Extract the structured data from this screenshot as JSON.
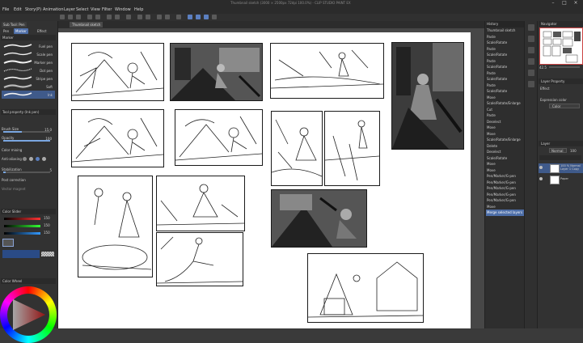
{
  "window": {
    "title": "Thumbnail sketch (3000 × 2500px 72dpi 100.0%) - CLIP STUDIO PAINT EX"
  },
  "menu": [
    "File",
    "Edit",
    "Story(P)",
    "Animation",
    "Layer",
    "Select",
    "View",
    "Filter",
    "Window",
    "Help"
  ],
  "left_panel": {
    "subtool_tabs": [
      "Sub Tool: Pen"
    ],
    "subtool_groups": [
      "Pen",
      "Marker",
      "Effect"
    ],
    "group_header": "Marker",
    "brushes": [
      "Fuel pen",
      "Scale pen",
      "Marker pen",
      "Dot pen",
      "Stripe pen",
      "Soft",
      "Ink"
    ],
    "tool_property_title": "Tool property (Ink pen)",
    "properties": [
      {
        "label": "Brush Size",
        "value": "15.0"
      },
      {
        "label": "Opacity",
        "value": "100"
      },
      {
        "label": "Color mixing",
        "value": ""
      },
      {
        "label": "Anti-aliasing",
        "value": ""
      },
      {
        "label": "Stabilization",
        "value": "5"
      },
      {
        "label": "Post correction",
        "value": ""
      },
      {
        "label": "Vector magnet",
        "value": ""
      }
    ],
    "color_slider_title": "Color Slider",
    "color_values": [
      "150",
      "150",
      "150"
    ],
    "color_wheel_title": "Color Wheel"
  },
  "canvas": {
    "tab_label": "Thumbnail sketch"
  },
  "history": {
    "title": "History",
    "items": [
      "Thumbnail sketch",
      "Paste",
      "Scale/Rotate",
      "Paste",
      "Scale/Rotate",
      "Paste",
      "Scale/Rotate",
      "Paste",
      "Scale/Rotate",
      "Paste",
      "Scale/Rotate",
      "Move",
      "Scale/Rotate/Enlarge",
      "Cut",
      "Paste",
      "Deselect",
      "Move",
      "Move",
      "Scale/Rotate/Enlarge",
      "Delete",
      "Deselect",
      "Scale/Rotate",
      "Move",
      "Move",
      "Pen/Marker/G-pen",
      "Pen/Marker/G-pen",
      "Pen/Marker/G-pen",
      "Pen/Marker/G-pen",
      "Pen/Marker/G-pen",
      "Move",
      "Merge selected layers"
    ],
    "selected_index": 30
  },
  "right_panel": {
    "navigator_title": "Navigator",
    "navigator_zoom": "42.5",
    "layer_property_title": "Layer Property",
    "effect_label": "Effect",
    "expression_color_label": "Expression color",
    "expression_color_value": "Color",
    "layer_title": "Layer",
    "blend_mode": "Normal",
    "opacity_value": "100",
    "layers": [
      {
        "name": "100 % Normal Layer 1 Copy"
      },
      {
        "name": "Paper"
      }
    ]
  }
}
